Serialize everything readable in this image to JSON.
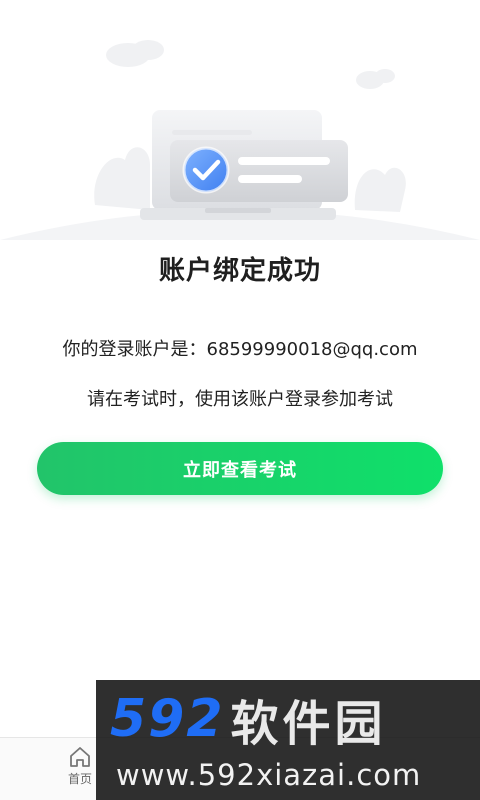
{
  "result": {
    "title": "账户绑定成功",
    "account_line": "你的登录账户是：68599990018@qq.com",
    "hint_line": "请在考试时，使用该账户登录参加考试"
  },
  "actions": {
    "view_exam_label": "立即查看考试"
  },
  "tabbar": {
    "home_label": "首页",
    "home_icon": "home-icon"
  },
  "watermark": {
    "brand_digits": "592",
    "brand_text": "软件园",
    "url": "www.592xiazai.com"
  },
  "colors": {
    "accent_green": "#1fd36a",
    "check_blue": "#3f7ff0",
    "watermark_blue": "#1f6df5"
  }
}
